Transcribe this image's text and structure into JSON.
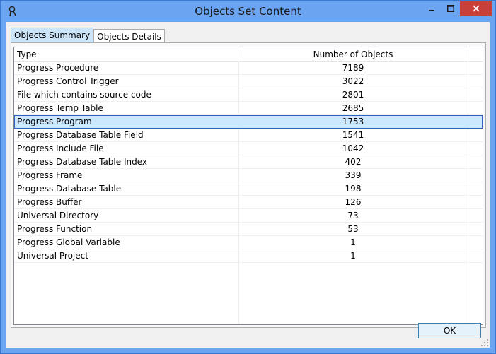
{
  "window": {
    "title": "Objects Set Content"
  },
  "tabs": [
    {
      "label": "Objects Summary"
    },
    {
      "label": "Objects Details"
    }
  ],
  "table": {
    "columns": [
      "Type",
      "Number of Objects"
    ],
    "rows": [
      {
        "type": "Progress Procedure",
        "count": "7189"
      },
      {
        "type": "Progress Control Trigger",
        "count": "3022"
      },
      {
        "type": "File which contains source code",
        "count": "2801"
      },
      {
        "type": "Progress Temp Table",
        "count": "2685"
      },
      {
        "type": "Progress Program",
        "count": "1753"
      },
      {
        "type": "Progress Database Table Field",
        "count": "1541"
      },
      {
        "type": "Progress Include File",
        "count": "1042"
      },
      {
        "type": "Progress Database Table Index",
        "count": "402"
      },
      {
        "type": "Progress Frame",
        "count": "339"
      },
      {
        "type": "Progress Database Table",
        "count": "198"
      },
      {
        "type": "Progress Buffer",
        "count": "126"
      },
      {
        "type": "Universal Directory",
        "count": "73"
      },
      {
        "type": "Progress Function",
        "count": "53"
      },
      {
        "type": "Progress Global Variable",
        "count": "1"
      },
      {
        "type": "Universal Project",
        "count": "1"
      }
    ],
    "selected_row": "Progress Program"
  },
  "buttons": {
    "ok": "OK"
  },
  "colors": {
    "title_bar": "#6ba5f2",
    "close_button": "#c7403a",
    "selection": "#cce8ff"
  },
  "icons": {
    "app": "app-icon",
    "minimize": "minimize-icon",
    "maximize": "maximize-icon",
    "close": "close-icon"
  }
}
